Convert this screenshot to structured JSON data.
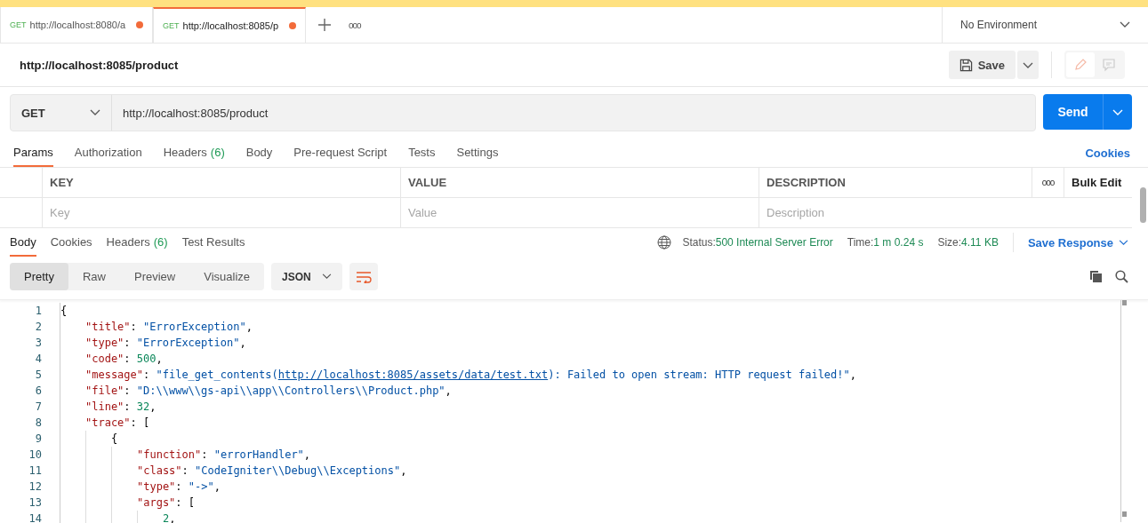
{
  "tabs": [
    {
      "method": "GET",
      "url": "http://localhost:8080/a",
      "unsaved": true,
      "selected": false
    },
    {
      "method": "GET",
      "url": "http://localhost:8085/p",
      "unsaved": true,
      "selected": true
    }
  ],
  "tab_more": "ooo",
  "environment": "No Environment",
  "request_title": "http://localhost:8085/product",
  "save_button": "Save",
  "method": "GET",
  "url": "http://localhost:8085/product",
  "send_button": "Send",
  "request_tabs": [
    {
      "label": "Params",
      "selected": true
    },
    {
      "label": "Authorization",
      "selected": false
    },
    {
      "label": "Headers",
      "count": "(6)",
      "selected": false
    },
    {
      "label": "Body",
      "selected": false
    },
    {
      "label": "Pre-request Script",
      "selected": false
    },
    {
      "label": "Tests",
      "selected": false
    },
    {
      "label": "Settings",
      "selected": false
    }
  ],
  "cookies_link": "Cookies",
  "params_table": {
    "columns": [
      "KEY",
      "VALUE",
      "DESCRIPTION"
    ],
    "more": "ooo",
    "bulk_edit": "Bulk Edit",
    "placeholders": [
      "Key",
      "Value",
      "Description"
    ]
  },
  "response_tabs": [
    {
      "label": "Body",
      "selected": true
    },
    {
      "label": "Cookies",
      "selected": false
    },
    {
      "label": "Headers",
      "count": "(6)",
      "selected": false
    },
    {
      "label": "Test Results",
      "selected": false
    }
  ],
  "status": {
    "label": "Status:",
    "value": "500 Internal Server Error"
  },
  "time": {
    "label": "Time:",
    "value": "1 m 0.24 s"
  },
  "size": {
    "label": "Size:",
    "value": "4.11 KB"
  },
  "save_response": "Save Response",
  "view_modes": [
    {
      "label": "Pretty",
      "selected": true
    },
    {
      "label": "Raw",
      "selected": false
    },
    {
      "label": "Preview",
      "selected": false
    },
    {
      "label": "Visualize",
      "selected": false
    }
  ],
  "format": "JSON",
  "code": [
    {
      "no": "1",
      "tokens": [
        {
          "kind": "punct",
          "text": "{"
        }
      ],
      "children": [
        {
          "no": "2",
          "tokens": [
            {
              "kind": "key",
              "text": "\"title\""
            },
            {
              "kind": "punct",
              "text": ": "
            },
            {
              "kind": "str",
              "text": "\"ErrorException\""
            },
            {
              "kind": "punct",
              "text": ","
            }
          ]
        },
        {
          "no": "3",
          "tokens": [
            {
              "kind": "key",
              "text": "\"type\""
            },
            {
              "kind": "punct",
              "text": ": "
            },
            {
              "kind": "str",
              "text": "\"ErrorException\""
            },
            {
              "kind": "punct",
              "text": ","
            }
          ]
        },
        {
          "no": "4",
          "tokens": [
            {
              "kind": "key",
              "text": "\"code\""
            },
            {
              "kind": "punct",
              "text": ": "
            },
            {
              "kind": "num",
              "text": "500"
            },
            {
              "kind": "punct",
              "text": ","
            }
          ]
        },
        {
          "no": "5",
          "tokens": [
            {
              "kind": "key",
              "text": "\"message\""
            },
            {
              "kind": "punct",
              "text": ": "
            },
            {
              "kind": "str",
              "text": "\"file_get_contents("
            },
            {
              "kind": "link",
              "text": "http://localhost:8085/assets/data/test.txt"
            },
            {
              "kind": "str",
              "text": "): Failed to open stream: HTTP request failed!\""
            },
            {
              "kind": "punct",
              "text": ","
            }
          ]
        },
        {
          "no": "6",
          "tokens": [
            {
              "kind": "key",
              "text": "\"file\""
            },
            {
              "kind": "punct",
              "text": ": "
            },
            {
              "kind": "str",
              "text": "\"D:\\\\www\\\\gs-api\\\\app\\\\Controllers\\\\Product.php\""
            },
            {
              "kind": "punct",
              "text": ","
            }
          ]
        },
        {
          "no": "7",
          "tokens": [
            {
              "kind": "key",
              "text": "\"line\""
            },
            {
              "kind": "punct",
              "text": ": "
            },
            {
              "kind": "num",
              "text": "32"
            },
            {
              "kind": "punct",
              "text": ","
            }
          ]
        },
        {
          "no": "8",
          "tokens": [
            {
              "kind": "key",
              "text": "\"trace\""
            },
            {
              "kind": "punct",
              "text": ": ["
            }
          ],
          "children": [
            {
              "no": "9",
              "tokens": [
                {
                  "kind": "punct",
                  "text": "{"
                }
              ],
              "children": [
                {
                  "no": "10",
                  "tokens": [
                    {
                      "kind": "key",
                      "text": "\"function\""
                    },
                    {
                      "kind": "punct",
                      "text": ": "
                    },
                    {
                      "kind": "str",
                      "text": "\"errorHandler\""
                    },
                    {
                      "kind": "punct",
                      "text": ","
                    }
                  ]
                },
                {
                  "no": "11",
                  "tokens": [
                    {
                      "kind": "key",
                      "text": "\"class\""
                    },
                    {
                      "kind": "punct",
                      "text": ": "
                    },
                    {
                      "kind": "str",
                      "text": "\"CodeIgniter\\\\Debug\\\\Exceptions\""
                    },
                    {
                      "kind": "punct",
                      "text": ","
                    }
                  ]
                },
                {
                  "no": "12",
                  "tokens": [
                    {
                      "kind": "key",
                      "text": "\"type\""
                    },
                    {
                      "kind": "punct",
                      "text": ": "
                    },
                    {
                      "kind": "str",
                      "text": "\"->\""
                    },
                    {
                      "kind": "punct",
                      "text": ","
                    }
                  ]
                },
                {
                  "no": "13",
                  "tokens": [
                    {
                      "kind": "key",
                      "text": "\"args\""
                    },
                    {
                      "kind": "punct",
                      "text": ": ["
                    }
                  ],
                  "children": [
                    {
                      "no": "14",
                      "tokens": [
                        {
                          "kind": "num",
                          "text": "2"
                        },
                        {
                          "kind": "punct",
                          "text": ","
                        }
                      ]
                    }
                  ]
                }
              ]
            }
          ]
        }
      ]
    }
  ]
}
